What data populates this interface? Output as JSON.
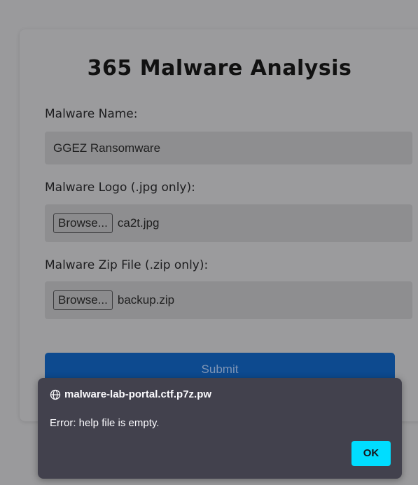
{
  "form": {
    "title": "365 Malware Analysis",
    "name_label": "Malware Name:",
    "name_value": "GGEZ Ransomware",
    "logo_label": "Malware Logo (.jpg only):",
    "logo_browse": "Browse...",
    "logo_file": "ca2t.jpg",
    "zip_label": "Malware Zip File (.zip only):",
    "zip_browse": "Browse...",
    "zip_file": "backup.zip",
    "submit_label": "Submit"
  },
  "dialog": {
    "origin": "malware-lab-portal.ctf.p7z.pw",
    "origin_icon": "globe-icon",
    "message": "Error: help file is empty.",
    "ok_label": "OK"
  },
  "colors": {
    "overlay": "#9a9a9c",
    "submit": "#0d4a8f",
    "dialog_bg": "#42414d",
    "ok_button": "#00ddff"
  }
}
